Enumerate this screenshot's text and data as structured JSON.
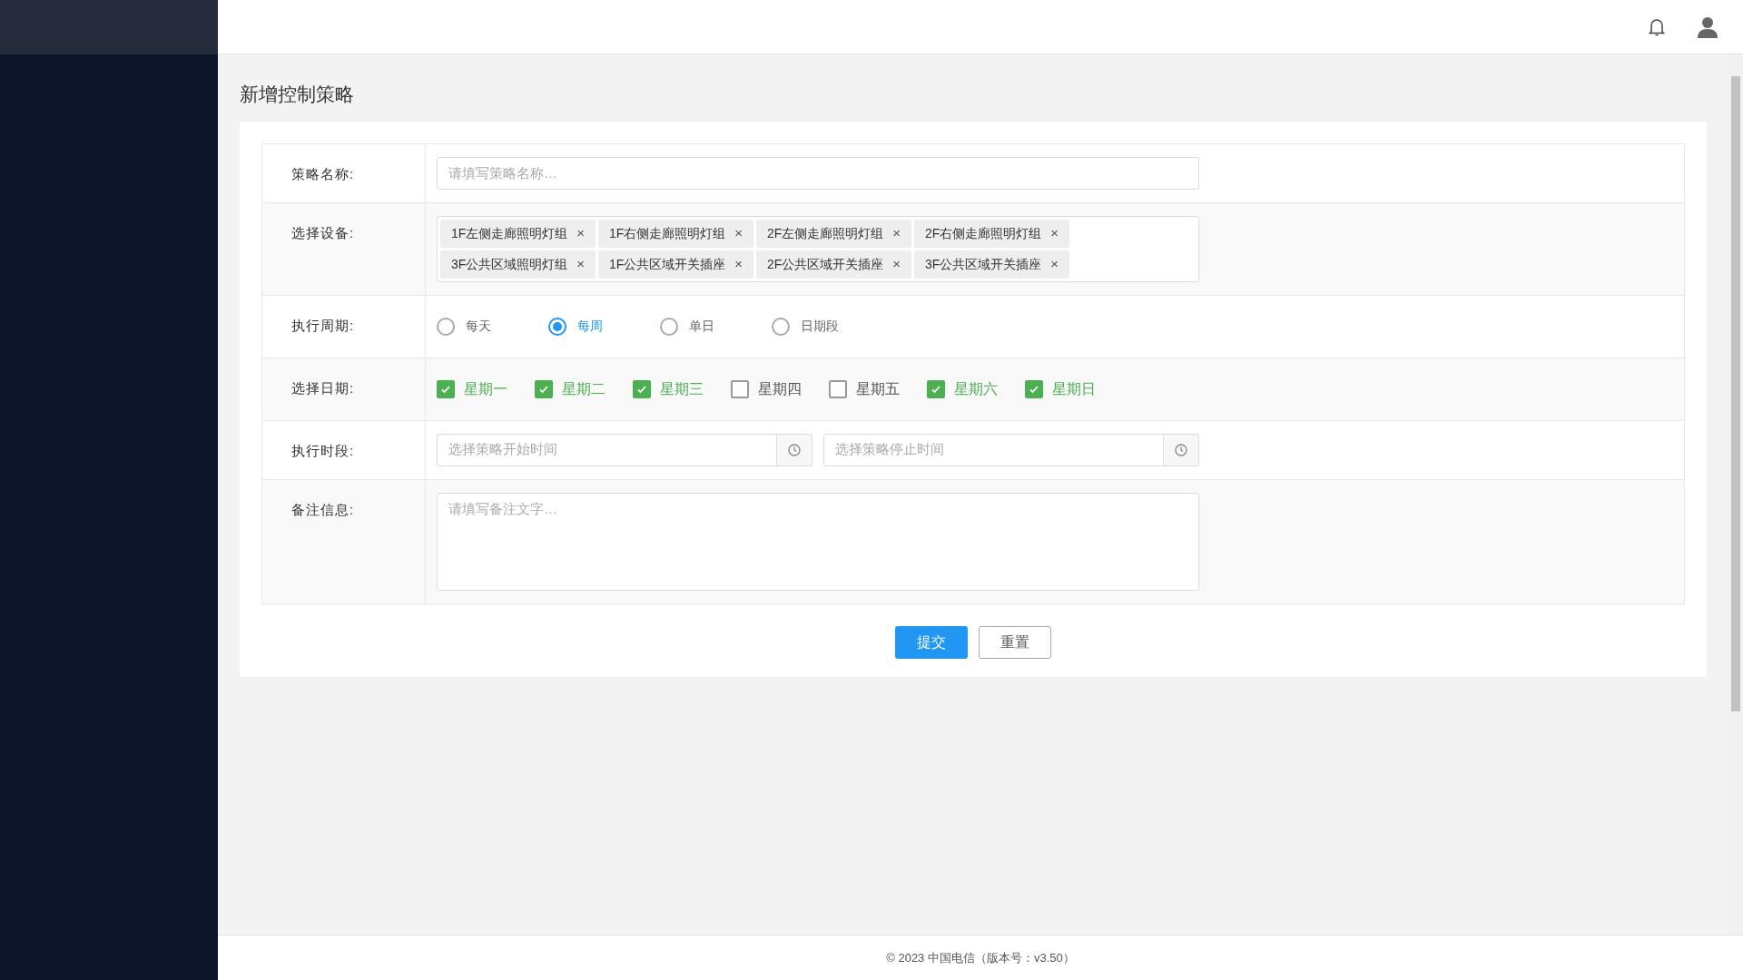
{
  "page_title": "新增控制策略",
  "form": {
    "name_field": {
      "label": "策略名称:",
      "placeholder": "请填写策略名称…"
    },
    "devices": {
      "label": "选择设备:",
      "tags": [
        {
          "text": "1F左侧走廊照明灯组",
          "remove": "×"
        },
        {
          "text": "1F右侧走廊照明灯组",
          "remove": "×"
        },
        {
          "text": "2F左侧走廊照明灯组",
          "remove": "×"
        },
        {
          "text": "2F右侧走廊照明灯组",
          "remove": "×"
        },
        {
          "text": "3F公共区域照明灯组",
          "remove": "×"
        },
        {
          "text": "1F公共区域开关插座",
          "remove": "×"
        },
        {
          "text": "2F公共区域开关插座",
          "remove": "×"
        },
        {
          "text": "3F公共区域开关插座",
          "remove": "×"
        }
      ]
    },
    "cycle": {
      "label": "执行周期:",
      "options": [
        {
          "text": "每天",
          "selected": false
        },
        {
          "text": "每周",
          "selected": true
        },
        {
          "text": "单日",
          "selected": false
        },
        {
          "text": "日期段",
          "selected": false
        }
      ]
    },
    "days": {
      "label": "选择日期:",
      "options": [
        {
          "text": "星期一",
          "checked": true
        },
        {
          "text": "星期二",
          "checked": true
        },
        {
          "text": "星期三",
          "checked": true
        },
        {
          "text": "星期四",
          "checked": false
        },
        {
          "text": "星期五",
          "checked": false
        },
        {
          "text": "星期六",
          "checked": true
        },
        {
          "text": "星期日",
          "checked": true
        }
      ]
    },
    "time": {
      "label": "执行时段:",
      "start_placeholder": "选择策略开始时间",
      "end_placeholder": "选择策略停止时间"
    },
    "notes": {
      "label": "备注信息:",
      "placeholder": "请填写备注文字…"
    }
  },
  "buttons": [
    {
      "text": "提交",
      "kind": "primary"
    },
    {
      "text": "重置",
      "kind": "default"
    }
  ],
  "footer": "© 2023 中国电信（版本号：v3.50）"
}
